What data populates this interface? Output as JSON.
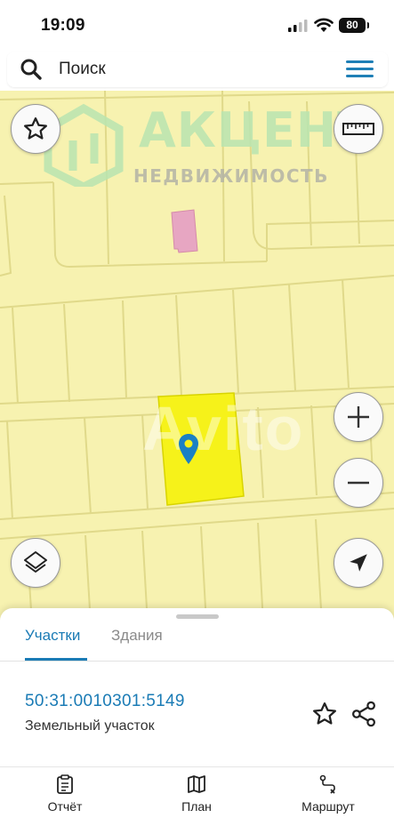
{
  "status_bar": {
    "time": "19:09",
    "battery": "80"
  },
  "search": {
    "placeholder": "Поиск"
  },
  "map": {
    "watermark_title": "АКЦЕНТ",
    "watermark_subtitle": "НЕДВИЖИМОСТЬ",
    "avito_watermark": "Avito",
    "colors": {
      "parcel_fill": "#f7f2b0",
      "selected_parcel": "#f6f21a",
      "building": "#e7a6c2",
      "accent": "#1a7bb5"
    }
  },
  "tabs": [
    {
      "label": "Участки",
      "active": true
    },
    {
      "label": "Здания",
      "active": false
    }
  ],
  "parcel": {
    "cadastral_number": "50:31:0010301:5149",
    "type": "Земельный участок"
  },
  "nav": {
    "report": "Отчёт",
    "plan": "План",
    "route": "Маршрут"
  }
}
